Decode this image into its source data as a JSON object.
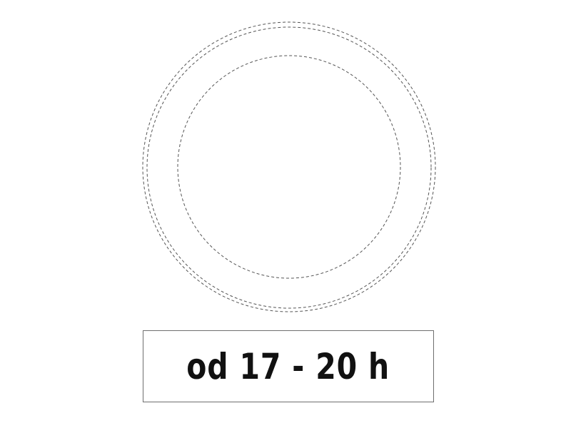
{
  "sign": {
    "shape": "circle",
    "outline": "dashed",
    "stroke_color": "#555555"
  },
  "plate": {
    "text": "od 17 - 20 h",
    "border_color": "#6e6e6e",
    "text_color": "#111111"
  }
}
